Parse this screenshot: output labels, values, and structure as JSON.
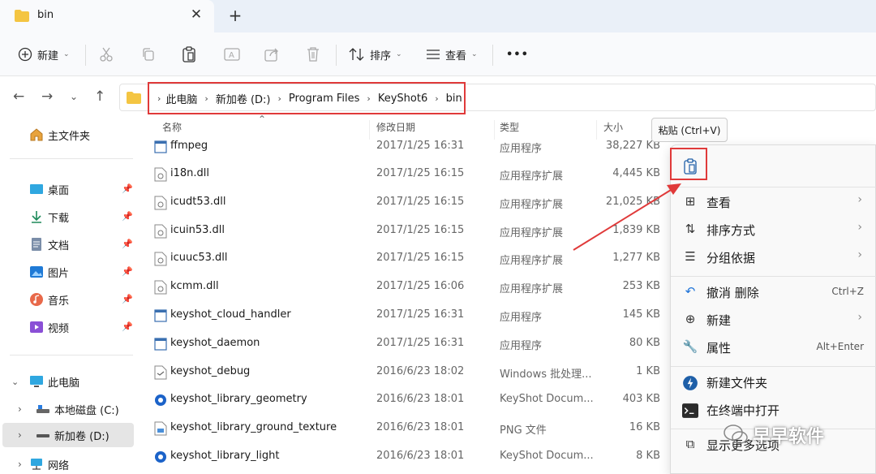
{
  "window": {
    "tab_title": "bin",
    "close_symbol": "✕",
    "new_tab_symbol": "+"
  },
  "toolbar": {
    "new_label": "新建",
    "sort_label": "排序",
    "view_label": "查看",
    "more_label": "•••"
  },
  "address": {
    "crumbs": [
      "此电脑",
      "新加卷 (D:)",
      "Program Files",
      "KeyShot6",
      "bin"
    ]
  },
  "sidebar": {
    "home": "主文件夹",
    "quick": [
      {
        "label": "桌面"
      },
      {
        "label": "下载"
      },
      {
        "label": "文档"
      },
      {
        "label": "图片"
      },
      {
        "label": "音乐"
      },
      {
        "label": "视频"
      }
    ],
    "pc": "此电脑",
    "drives": [
      {
        "label": "本地磁盘 (C:)"
      },
      {
        "label": "新加卷 (D:)"
      }
    ],
    "network": "网络"
  },
  "columns": {
    "name": "名称",
    "date": "修改日期",
    "type": "类型",
    "size": "大小"
  },
  "files": [
    {
      "name": "ffmpeg",
      "date": "2017/1/25 16:31",
      "type": "应用程序",
      "size": "38,227 KB"
    },
    {
      "name": "i18n.dll",
      "date": "2017/1/25 16:15",
      "type": "应用程序扩展",
      "size": "4,445 KB"
    },
    {
      "name": "icudt53.dll",
      "date": "2017/1/25 16:15",
      "type": "应用程序扩展",
      "size": "21,025 KB"
    },
    {
      "name": "icuin53.dll",
      "date": "2017/1/25 16:15",
      "type": "应用程序扩展",
      "size": "1,839 KB"
    },
    {
      "name": "icuuc53.dll",
      "date": "2017/1/25 16:15",
      "type": "应用程序扩展",
      "size": "1,277 KB"
    },
    {
      "name": "kcmm.dll",
      "date": "2017/1/25 16:06",
      "type": "应用程序扩展",
      "size": "253 KB"
    },
    {
      "name": "keyshot_cloud_handler",
      "date": "2017/1/25 16:31",
      "type": "应用程序",
      "size": "145 KB"
    },
    {
      "name": "keyshot_daemon",
      "date": "2017/1/25 16:31",
      "type": "应用程序",
      "size": "80 KB"
    },
    {
      "name": "keyshot_debug",
      "date": "2016/6/23 18:02",
      "type": "Windows 批处理...",
      "size": "1 KB"
    },
    {
      "name": "keyshot_library_geometry",
      "date": "2016/6/23 18:01",
      "type": "KeyShot Docum...",
      "size": "403 KB"
    },
    {
      "name": "keyshot_library_ground_texture",
      "date": "2016/6/23 18:01",
      "type": "PNG 文件",
      "size": "16 KB"
    },
    {
      "name": "keyshot_library_light",
      "date": "2016/6/23 18:01",
      "type": "KeyShot Docum...",
      "size": "8 KB"
    }
  ],
  "tooltip": "粘贴 (Ctrl+V)",
  "context_menu": {
    "view": "查看",
    "sort": "排序方式",
    "group": "分组依据",
    "undo": "撤消 删除",
    "undo_shortcut": "Ctrl+Z",
    "new": "新建",
    "properties": "属性",
    "properties_shortcut": "Alt+Enter",
    "new_folder": "新建文件夹",
    "terminal": "在终端中打开",
    "more": "显示更多选项"
  },
  "watermark": "早早软件",
  "colors": {
    "accent_red": "#e03a3a",
    "folder_yellow": "#f4c542",
    "blue": "#1e73d8"
  }
}
